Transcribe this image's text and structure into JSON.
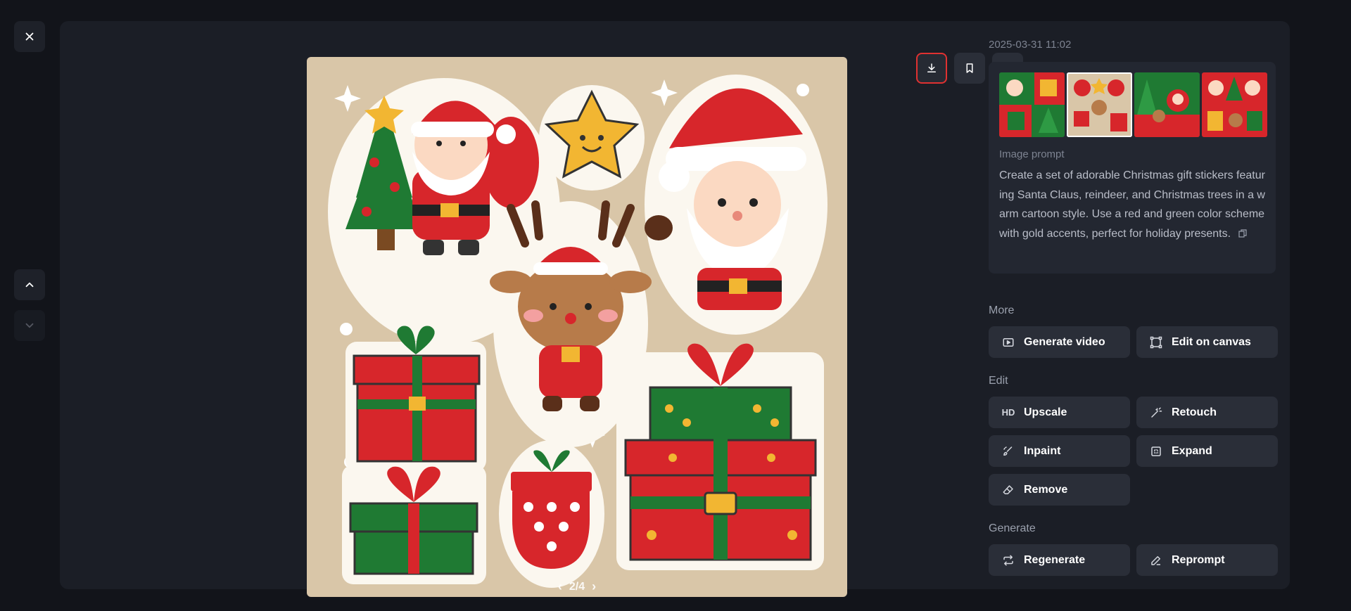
{
  "viewer": {
    "pager": "2/4",
    "timestamp": "2025-03-31 11:02"
  },
  "prompt": {
    "label": "Image prompt",
    "text": "Create a set of adorable Christmas gift stickers featuring Santa Claus, reindeer, and Christmas trees in a warm cartoon style. Use a red and green color scheme with gold accents, perfect for holiday presents."
  },
  "sections": {
    "more": "More",
    "edit": "Edit",
    "generate": "Generate"
  },
  "buttons": {
    "generate_video": "Generate video",
    "edit_on_canvas": "Edit on canvas",
    "upscale": "Upscale",
    "upscale_badge": "HD",
    "retouch": "Retouch",
    "inpaint": "Inpaint",
    "expand": "Expand",
    "remove": "Remove",
    "regenerate": "Regenerate",
    "reprompt": "Reprompt"
  },
  "icons": {
    "close": "close-icon",
    "up": "chevron-up-icon",
    "down": "chevron-down-icon",
    "download": "download-icon",
    "bookmark": "bookmark-icon",
    "more": "more-icon",
    "copy": "copy-icon"
  },
  "colors": {
    "background": "#12141a",
    "panel": "#1b1e26",
    "button": "#2a2e38",
    "highlight": "#e03131",
    "sticker_red": "#d7262b",
    "sticker_green": "#1f7a33",
    "sticker_gold": "#f2b632"
  }
}
